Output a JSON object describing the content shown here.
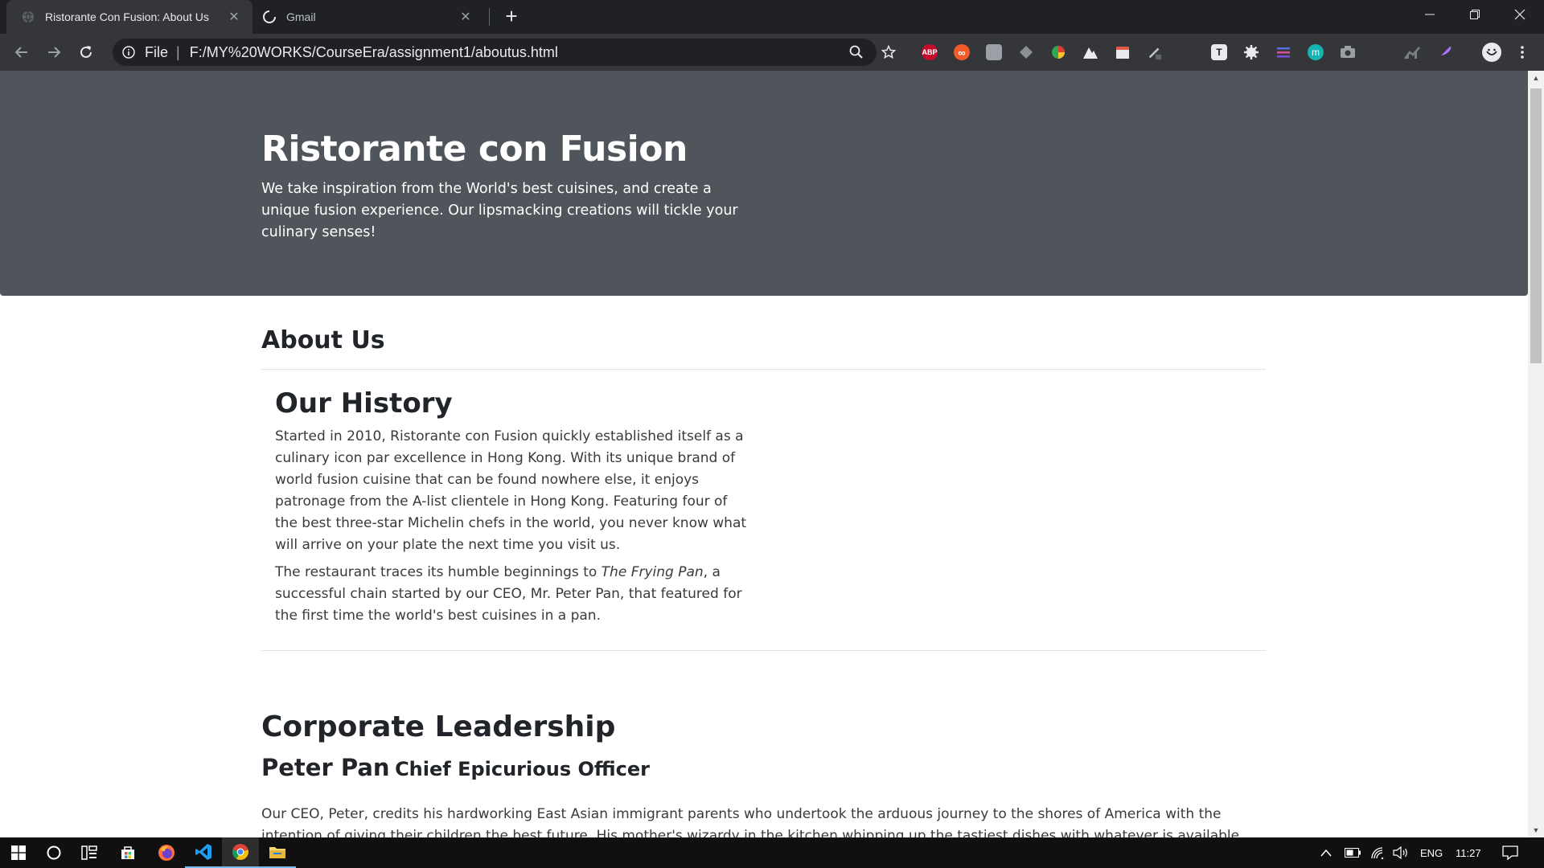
{
  "browser": {
    "tabs": [
      {
        "title": "Ristorante Con Fusion: About Us",
        "active": true
      },
      {
        "title": "Gmail",
        "active": false
      }
    ],
    "address": {
      "scheme": "File",
      "url": "F:/MY%20WORKS/CourseEra/assignment1/aboutus.html"
    },
    "extensions": [
      {
        "name": "abp-icon",
        "label": "ABP",
        "color": "#c70d2c"
      },
      {
        "name": "infinity-icon",
        "label": "∞",
        "color": "#f25a29"
      },
      {
        "name": "evernote-icon",
        "label": "",
        "color": "#9aa0a6"
      },
      {
        "name": "layers-icon",
        "label": "",
        "color": "#8a8f94"
      },
      {
        "name": "colorwheel-icon",
        "label": "",
        "color": "#2fa84f"
      },
      {
        "name": "mountain-icon",
        "label": "",
        "color": "#e8eaed"
      },
      {
        "name": "calendar-icon",
        "label": "",
        "color": "#e8eaed"
      },
      {
        "name": "pen-icon",
        "label": "",
        "color": "#bdc1c6"
      },
      {
        "name": "t-icon",
        "label": "T",
        "color": "#e8eaed"
      },
      {
        "name": "gear-ext-icon",
        "label": "",
        "color": "#e8eaed"
      },
      {
        "name": "stack-icon",
        "label": "",
        "color": "#7b4fd6"
      },
      {
        "name": "m-icon",
        "label": "m",
        "color": "#16b3b3"
      },
      {
        "name": "camera-icon",
        "label": "",
        "color": "#9aa0a6"
      },
      {
        "name": "chart-ext-icon",
        "label": "",
        "color": "#7a7f84"
      },
      {
        "name": "feather-icon",
        "label": "",
        "color": "#a875ff"
      }
    ]
  },
  "page": {
    "jumbotron": {
      "title": "Ristorante con Fusion",
      "text": "We take inspiration from the World's best cuisines, and create a unique fusion experience. Our lipsmacking creations will tickle your culinary senses!"
    },
    "about_heading": "About Us",
    "history": {
      "heading": "Our History",
      "p1": "Started in 2010, Ristorante con Fusion quickly established itself as a culinary icon par excellence in Hong Kong. With its unique brand of world fusion cuisine that can be found nowhere else, it enjoys patronage from the A-list clientele in Hong Kong. Featuring four of the best three-star Michelin chefs in the world, you never know what will arrive on your plate the next time you visit us.",
      "p2_before": "The restaurant traces its humble beginnings to ",
      "p2_italic": "The Frying Pan",
      "p2_after": ", a successful chain started by our CEO, Mr. Peter Pan, that featured for the first time the world's best cuisines in a pan."
    },
    "corporate": {
      "heading": "Corporate Leadership",
      "leader_name": "Peter Pan",
      "leader_title": "Chief Epicurious Officer",
      "leader_text": "Our CEO, Peter, credits his hardworking East Asian immigrant parents who undertook the arduous journey to the shores of America with the intention of giving their children the best future. His mother's wizardy in the kitchen whipping up the tastiest dishes with whatever is available inexpensively at the"
    }
  },
  "taskbar": {
    "tray": {
      "language": "ENG",
      "time": "11:27"
    }
  },
  "colors": {
    "jumbotron_bg": "#50555b",
    "chrome_dark": "#202124",
    "chrome_toolbar": "#35363a"
  }
}
